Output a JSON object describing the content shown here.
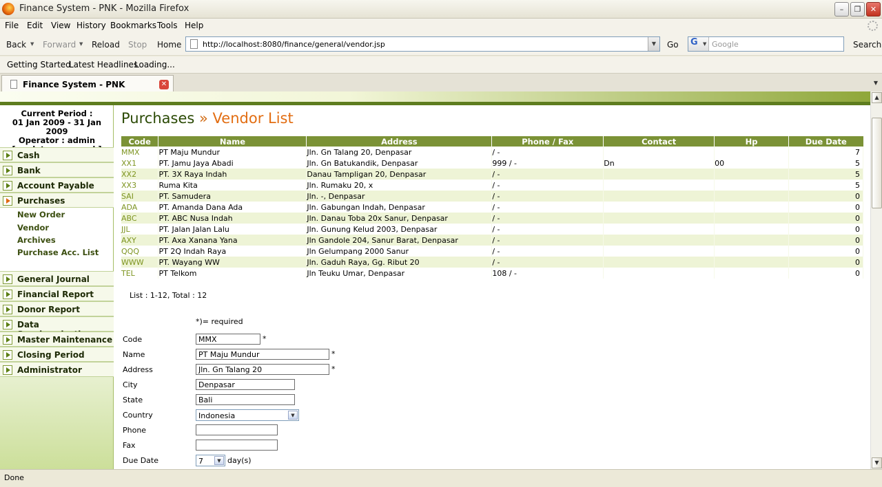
{
  "window": {
    "title": "Finance System - PNK - Mozilla Firefox"
  },
  "menubar": [
    "File",
    "Edit",
    "View",
    "History",
    "Bookmarks",
    "Tools",
    "Help"
  ],
  "navbar": {
    "back": "Back",
    "forward": "Forward",
    "reload": "Reload",
    "stop": "Stop",
    "home": "Home",
    "url": "http://localhost:8080/finance/general/vendor.jsp",
    "go": "Go",
    "search_placeholder": "Google",
    "search": "Search"
  },
  "bookmarks": [
    "Getting Started",
    "Latest Headlines",
    "Loading..."
  ],
  "tab": {
    "title": "Finance System - PNK"
  },
  "sidebar": {
    "period_label": "Current Period :",
    "period": "01 Jan 2009 - 31 Jan 2009",
    "operator": "Operator : admin",
    "update_password": "[ update password ]",
    "menu_top": [
      "Cash",
      "Bank",
      "Account Payable",
      "Purchases"
    ],
    "submenu": [
      "New Order",
      "Vendor",
      "Archives",
      "Purchase Acc. List"
    ],
    "menu_bottom": [
      "General Journal",
      "Financial Report",
      "Donor Report",
      "Data Synchronization",
      "Master Maintenance",
      "Closing Period",
      "Administrator"
    ]
  },
  "heading": {
    "section": "Purchases",
    "separator": "»",
    "page": "Vendor List"
  },
  "table": {
    "columns": [
      "Code",
      "Name",
      "Address",
      "Phone / Fax",
      "Contact",
      "Hp",
      "Due Date"
    ],
    "rows": [
      [
        "MMX",
        "PT Maju Mundur",
        "Jln. Gn Talang 20, Denpasar",
        "/ -",
        "",
        "",
        "7"
      ],
      [
        "XX1",
        "PT. Jamu Jaya Abadi",
        "Jln. Gn Batukandik, Denpasar",
        "999 / -",
        "Dn",
        "00",
        "5"
      ],
      [
        "XX2",
        "PT. 3X Raya Indah",
        "Danau Tampligan 20, Denpasar",
        "/ -",
        "",
        "",
        "5"
      ],
      [
        "XX3",
        "Ruma Kita",
        "Jln. Rumaku 20, x",
        "/ -",
        "",
        "",
        "5"
      ],
      [
        "SAI",
        "PT. Samudera",
        "Jln. -, Denpasar",
        "/ -",
        "",
        "",
        "0"
      ],
      [
        "ADA",
        "PT. Amanda Dana Ada",
        "Jln. Gabungan Indah, Denpasar",
        "/ -",
        "",
        "",
        "0"
      ],
      [
        "ABC",
        "PT. ABC Nusa Indah",
        "Jln. Danau Toba 20x Sanur, Denpasar",
        "/ -",
        "",
        "",
        "0"
      ],
      [
        "JJL",
        "PT. Jalan Jalan Lalu",
        "Jln. Gunung Kelud 2003, Denpasar",
        "/ -",
        "",
        "",
        "0"
      ],
      [
        "AXY",
        "PT. Axa Xanana Yana",
        "Jln Gandole 204, Sanur Barat, Denpasar",
        "/ -",
        "",
        "",
        "0"
      ],
      [
        "QQQ",
        "PT 2Q Indah Raya",
        "Jln Gelumpang 2000 Sanur",
        "/ -",
        "",
        "",
        "0"
      ],
      [
        "WWW",
        "PT. Wayang WW",
        "Jln. Gaduh Raya, Gg. Ribut 20",
        "/ -",
        "",
        "",
        "0"
      ],
      [
        "TEL",
        "PT Telkom",
        "Jln Teuku Umar, Denpasar",
        "108 / -",
        "",
        "",
        "0"
      ]
    ]
  },
  "list_info": "List : 1-12, Total : 12",
  "form": {
    "required_note": "*)= required",
    "star": "*",
    "code": {
      "label": "Code",
      "value": "MMX"
    },
    "name": {
      "label": "Name",
      "value": "PT Maju Mundur"
    },
    "address": {
      "label": "Address",
      "value": "Jln. Gn Talang 20"
    },
    "city": {
      "label": "City",
      "value": "Denpasar"
    },
    "state": {
      "label": "State",
      "value": "Bali"
    },
    "country": {
      "label": "Country",
      "value": "Indonesia"
    },
    "phone": {
      "label": "Phone",
      "value": ""
    },
    "fax": {
      "label": "Fax",
      "value": ""
    },
    "due_date": {
      "label": "Due Date",
      "value": "7",
      "unit": "day(s)"
    }
  },
  "status": "Done"
}
